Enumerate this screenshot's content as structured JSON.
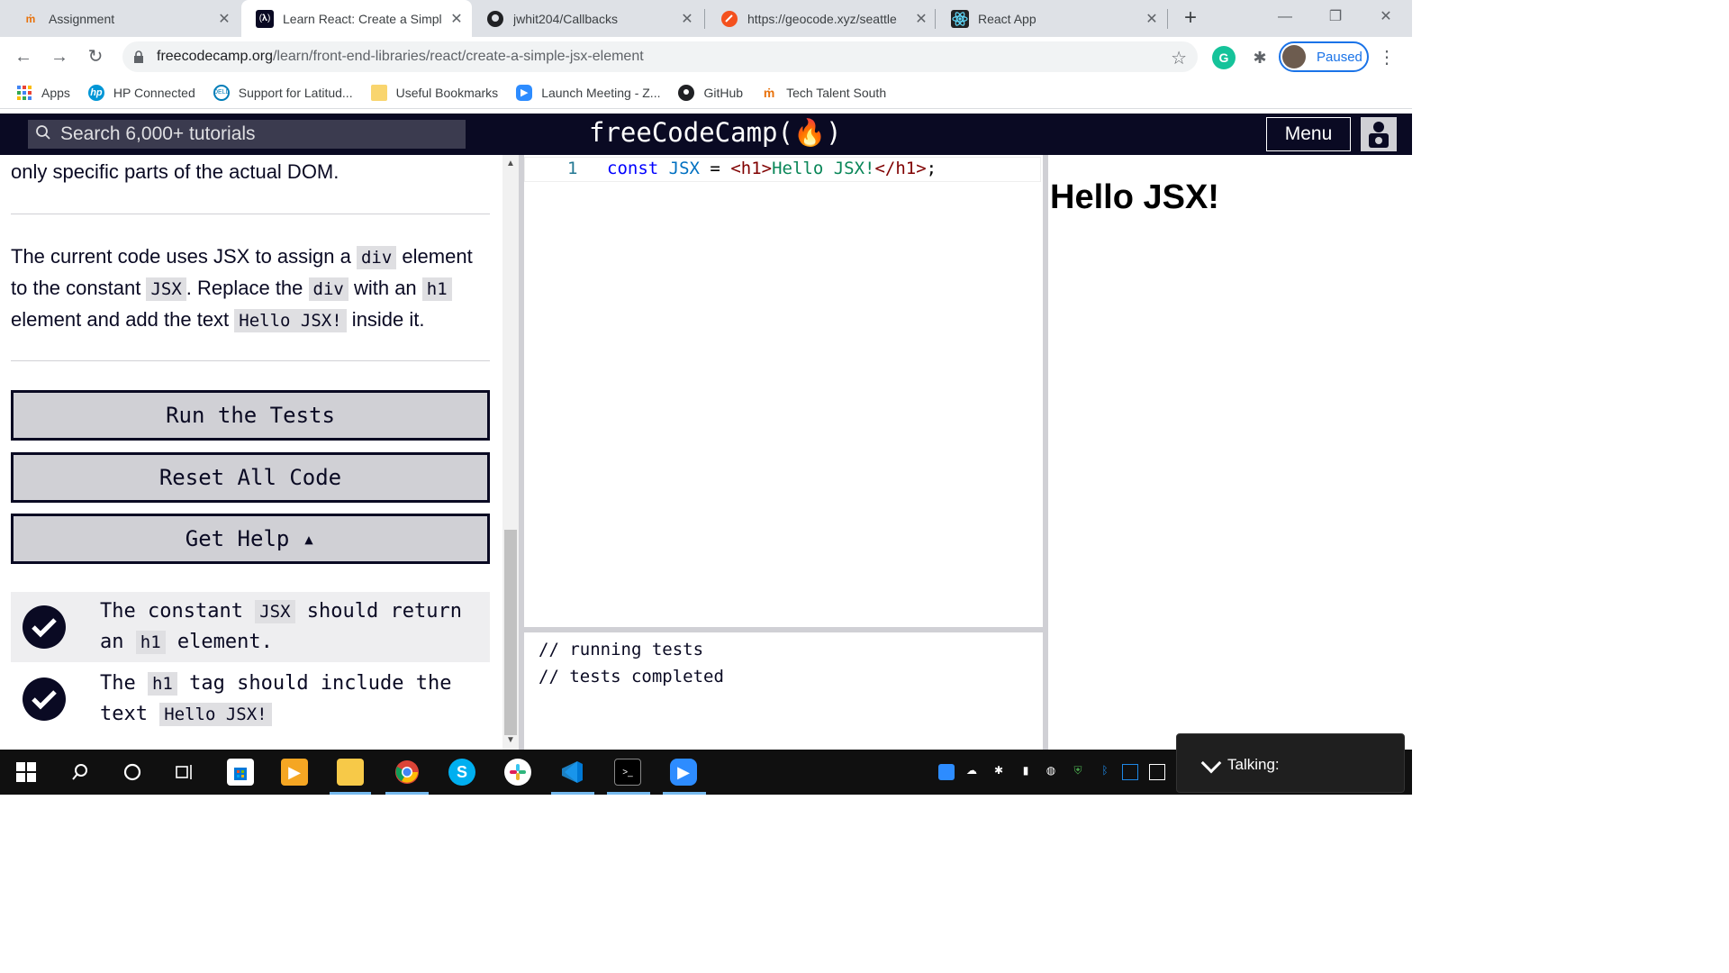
{
  "browser": {
    "tabs": [
      {
        "title": "Assignment",
        "icon": "tts-icon"
      },
      {
        "title": "Learn React: Create a Simpl",
        "icon": "fcc-icon"
      },
      {
        "title": "jwhit204/Callbacks",
        "icon": "github-icon"
      },
      {
        "title": "https://geocode.xyz/seattle",
        "icon": "geocode-icon"
      },
      {
        "title": "React App",
        "icon": "react-icon"
      }
    ],
    "url_host": "freecodecamp.org",
    "url_path": "/learn/front-end-libraries/react/create-a-simple-jsx-element",
    "profile_status": "Paused",
    "bookmarks": [
      {
        "label": "Apps"
      },
      {
        "label": "HP Connected"
      },
      {
        "label": "Support for Latitud..."
      },
      {
        "label": "Useful Bookmarks"
      },
      {
        "label": "Launch Meeting - Z..."
      },
      {
        "label": "GitHub"
      },
      {
        "label": "Tech Talent South"
      }
    ]
  },
  "fcc": {
    "search_placeholder": "Search 6,000+ tutorials",
    "logo": "freeCodeCamp(🔥)",
    "menu_label": "Menu"
  },
  "lesson": {
    "desc_top": "only specific parts of the actual DOM.",
    "desc": {
      "p1": "The current code uses JSX to assign a ",
      "c1": "div",
      "p2": " element to the constant ",
      "c2": "JSX",
      "p3": ". Replace the ",
      "c3": "div",
      "p4": " with an ",
      "c4": "h1",
      "p5": " element and add the text ",
      "c5": "Hello JSX!",
      "p6": " inside it."
    },
    "buttons": {
      "run": "Run the Tests",
      "reset": "Reset All Code",
      "help": "Get Help ▴"
    },
    "tests": [
      {
        "a": "The constant ",
        "c1": "JSX",
        "b": " should return an ",
        "c2": "h1",
        "d": " element.",
        "passed": true
      },
      {
        "a": "The ",
        "c1": "h1",
        "b": " tag should include the text ",
        "c2": "Hello JSX!",
        "d": "",
        "passed": true
      }
    ]
  },
  "editor": {
    "line_number": "1",
    "code": {
      "kw": "const",
      "name": "JSX",
      "eq": " = ",
      "open": "<h1>",
      "text": "Hello JSX!",
      "close": "</h1>",
      "end": ";"
    }
  },
  "console": {
    "lines": [
      "// running tests",
      "// tests completed"
    ]
  },
  "preview": {
    "heading": "Hello JSX!"
  },
  "taskbar": {
    "talking_label": "Talking:"
  },
  "colors": {
    "fcc_dark": "#0a0a23",
    "fcc_gray": "#d0d0d5",
    "chrome_blue": "#1a73e8"
  }
}
